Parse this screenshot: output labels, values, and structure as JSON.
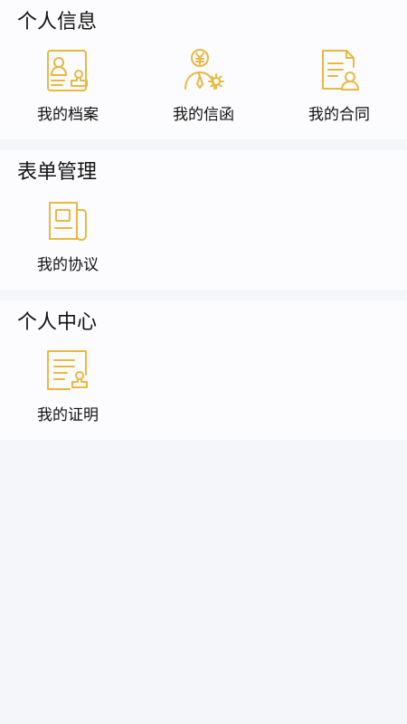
{
  "sections": [
    {
      "title": "个人信息",
      "items": [
        {
          "label": "我的档案",
          "icon": "id-card-icon"
        },
        {
          "label": "我的信函",
          "icon": "person-yuan-gear-icon"
        },
        {
          "label": "我的合同",
          "icon": "document-person-icon"
        }
      ]
    },
    {
      "title": "表单管理",
      "items": [
        {
          "label": "我的协议",
          "icon": "scroll-document-icon"
        }
      ]
    },
    {
      "title": "个人中心",
      "items": [
        {
          "label": "我的证明",
          "icon": "certificate-stamp-icon"
        }
      ]
    }
  ],
  "colors": {
    "accent": "#e9b840",
    "background": "#f5f6f9",
    "card": "#fcfcfe"
  }
}
